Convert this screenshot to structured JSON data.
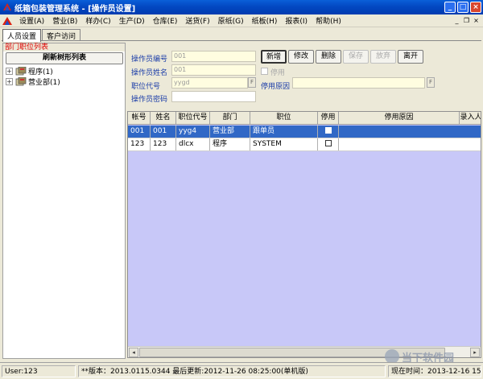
{
  "window": {
    "title": "纸箱包装管理系统 - [操作员设置]",
    "min_label": "_",
    "max_label": "□",
    "close_label": "×"
  },
  "menu": {
    "items": [
      "设置(A)",
      "营业(B)",
      "样办(C)",
      "生产(D)",
      "仓库(E)",
      "送货(F)",
      "原纸(G)",
      "纸板(H)",
      "报表(I)",
      "帮助(H)"
    ],
    "mdi_min": "_",
    "mdi_restore": "❐",
    "mdi_close": "×"
  },
  "tabs": [
    "人员设置",
    "客户访问"
  ],
  "left": {
    "caption": "部门职位列表",
    "refresh_label": "刷新树形列表",
    "tree": [
      {
        "expander": "+",
        "label": "程序(1)"
      },
      {
        "expander": "+",
        "label": "营业部(1)"
      }
    ]
  },
  "form": {
    "operator_id": {
      "label": "操作员编号",
      "value": "001"
    },
    "operator_name": {
      "label": "操作员姓名",
      "value": "001"
    },
    "position_code": {
      "label": "职位代号",
      "value": "yygd"
    },
    "disabled": {
      "label": "停用"
    },
    "disable_reason": {
      "label": "停用原因",
      "value": ""
    },
    "password": {
      "label": "操作员密码",
      "value": ""
    },
    "dots_label": "F"
  },
  "actions": {
    "add": "新增",
    "edit": "修改",
    "delete": "删除",
    "save": "保存",
    "discard": "放弃",
    "exit": "离开"
  },
  "grid": {
    "columns": [
      "帐号",
      "姓名",
      "职位代号",
      "部门",
      "职位",
      "停用",
      "停用原因",
      "录入人"
    ],
    "rows": [
      {
        "account": "001",
        "name": "001",
        "code": "yyg4",
        "dept": "营业部",
        "position": "跟单员",
        "reason": "",
        "entered_by": ""
      },
      {
        "account": "123",
        "name": "123",
        "code": "dlcx",
        "dept": "程序",
        "position": "SYSTEM",
        "reason": "",
        "entered_by": ""
      }
    ],
    "scroll_left": "◂",
    "scroll_right": "▸"
  },
  "status": {
    "user": "User:123",
    "version": "**版本：2013.0115.0344  最后更新:2012-11-26 08:25:00(单机版)",
    "time": "现在时间：2013-12-16 15:"
  },
  "watermark": "当下软件园",
  "colors": {
    "titlebar": "#0348c2",
    "selection": "#3168c6",
    "grid_bg": "#c8c8f8",
    "caption_red": "#e00000",
    "label_blue": "#1a3ca8"
  }
}
